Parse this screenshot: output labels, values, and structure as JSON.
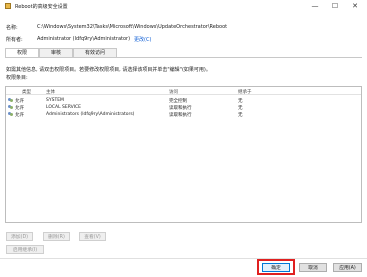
{
  "window": {
    "title": "Reboot的高级安全设置",
    "minimize": "—",
    "maximize": "☐",
    "close": "✕"
  },
  "info": {
    "name_label": "名称:",
    "name_value": "C:\\Windows\\System32\\Tasks\\Microsoft\\Windows\\UpdateOrchestrator\\Reboot",
    "owner_label": "所有者:",
    "owner_value": "Administrator (ldfq9ry\\Administrator)",
    "owner_change_link": "更改(C)"
  },
  "tabs": [
    {
      "label": "权限",
      "active": true
    },
    {
      "label": "审核",
      "active": false
    },
    {
      "label": "有效访问",
      "active": false
    }
  ],
  "hint": {
    "line1": "如需其他信息, 请双击权限项目。若要修改权限项目, 请选择该项目并单击\"编辑\"(如果可用)。",
    "line2": "权限条目:"
  },
  "permissions": {
    "columns": [
      "类型",
      "主体",
      "访问",
      "继承于"
    ],
    "rows": [
      {
        "type": "允许",
        "principal": "SYSTEM",
        "access": "完全控制",
        "inherited": "无"
      },
      {
        "type": "允许",
        "principal": "LOCAL SERVICE",
        "access": "读取和执行",
        "inherited": "无"
      },
      {
        "type": "允许",
        "principal": "Administrators (ldfq9ry\\Administrators)",
        "access": "读取和执行",
        "inherited": "无"
      }
    ]
  },
  "actions": {
    "add": "添加(D)",
    "remove": "删除(R)",
    "view": "查看(V)",
    "enable_inheritance": "启用继承(I)"
  },
  "footer": {
    "ok": "确定",
    "cancel": "取消",
    "apply": "应用(A)"
  },
  "colors": {
    "highlight_border": "#e02020",
    "link": "#0b5cd5"
  }
}
